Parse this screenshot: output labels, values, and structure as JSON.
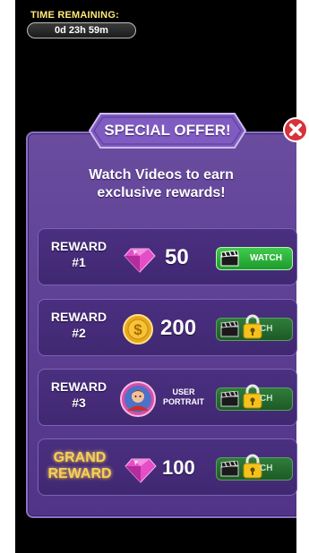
{
  "timer": {
    "label": "TIME REMAINING:",
    "value": "0d 23h 59m"
  },
  "dialog": {
    "title": "SPECIAL OFFER!",
    "subtitle_line1": "Watch Videos to earn",
    "subtitle_line2": "exclusive rewards!"
  },
  "rewards": [
    {
      "label_line1": "REWARD",
      "label_line2": "#1",
      "icon": "gem-icon",
      "amount": "50",
      "button": "WATCH",
      "locked": false
    },
    {
      "label_line1": "REWARD",
      "label_line2": "#2",
      "icon": "coin-icon",
      "amount": "200",
      "button": "CH",
      "locked": true
    },
    {
      "label_line1": "REWARD",
      "label_line2": "#3",
      "icon": "portrait-icon",
      "amount_line1": "USER",
      "amount_line2": "PORTRAIT",
      "button": "CH",
      "locked": true
    },
    {
      "label_line1": "GRAND",
      "label_line2": "REWARD",
      "icon": "gem-icon",
      "amount": "100",
      "button": "CH",
      "locked": true
    }
  ],
  "colors": {
    "panel": "#5a3c91",
    "row": "#4a2f80",
    "watch_green": "#2fb83e",
    "gold": "#f6cf5b",
    "close_red": "#d8323a"
  }
}
